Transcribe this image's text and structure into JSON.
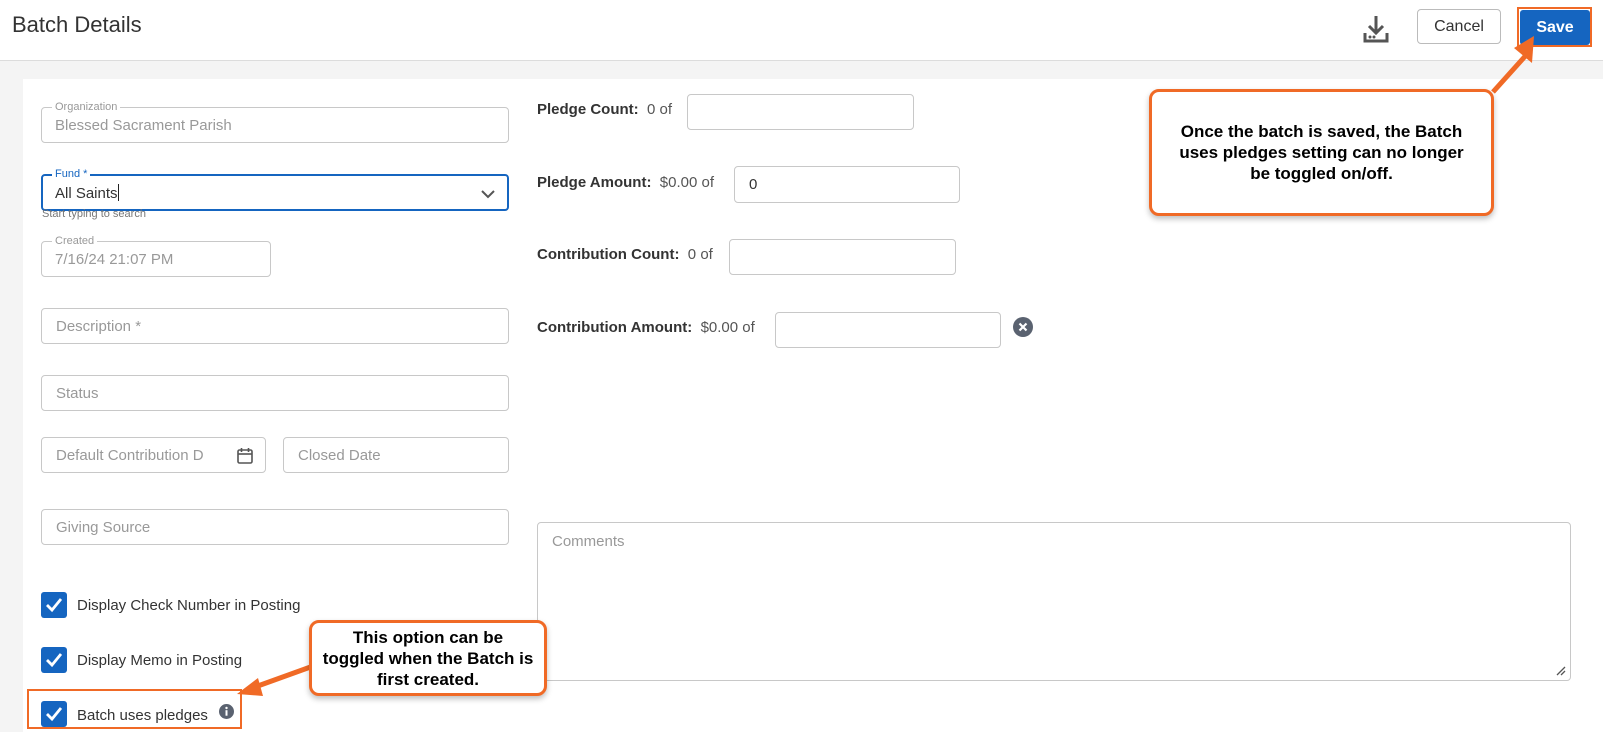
{
  "header": {
    "title": "Batch Details",
    "cancel_label": "Cancel",
    "save_label": "Save"
  },
  "form": {
    "organization": {
      "label": "Organization",
      "value": "Blessed Sacrament Parish"
    },
    "fund": {
      "label": "Fund *",
      "value": "All Saints",
      "helper": "Start typing to search"
    },
    "created": {
      "label": "Created",
      "value": "7/16/24 21:07 PM"
    },
    "description": {
      "placeholder": "Description *"
    },
    "status": {
      "placeholder": "Status"
    },
    "default_contribution_date": {
      "placeholder": "Default Contribution D"
    },
    "closed_date": {
      "placeholder": "Closed Date"
    },
    "giving_source": {
      "placeholder": "Giving Source"
    }
  },
  "totals": {
    "pledge_count": {
      "label": "Pledge Count:",
      "value": "0",
      "of": "of",
      "input": ""
    },
    "pledge_amount": {
      "label": "Pledge Amount:",
      "value": "$0.00",
      "of": "of",
      "input": "0"
    },
    "contribution_count": {
      "label": "Contribution Count:",
      "value": "0",
      "of": "of",
      "input": ""
    },
    "contribution_amount": {
      "label": "Contribution Amount:",
      "value": "$0.00",
      "of": "of",
      "input": ""
    }
  },
  "comments": {
    "placeholder": "Comments"
  },
  "checkboxes": [
    {
      "label": "Display Check Number in Posting",
      "checked": true
    },
    {
      "label": "Display Memo in Posting",
      "checked": true
    },
    {
      "label": "Batch uses pledges",
      "checked": true
    }
  ],
  "annotations": {
    "save_callout": "Once the batch is saved, the Batch uses pledges setting can no longer be toggled on/off.",
    "pledges_callout": "This option can be toggled when the Batch is first created."
  },
  "colors": {
    "primary": "#1565c0",
    "annotation": "#f06a26"
  },
  "icons": [
    "download-icon",
    "chevron-down-icon",
    "calendar-icon",
    "clear-icon",
    "checkmark-icon",
    "info-icon",
    "resize-grip-icon"
  ]
}
